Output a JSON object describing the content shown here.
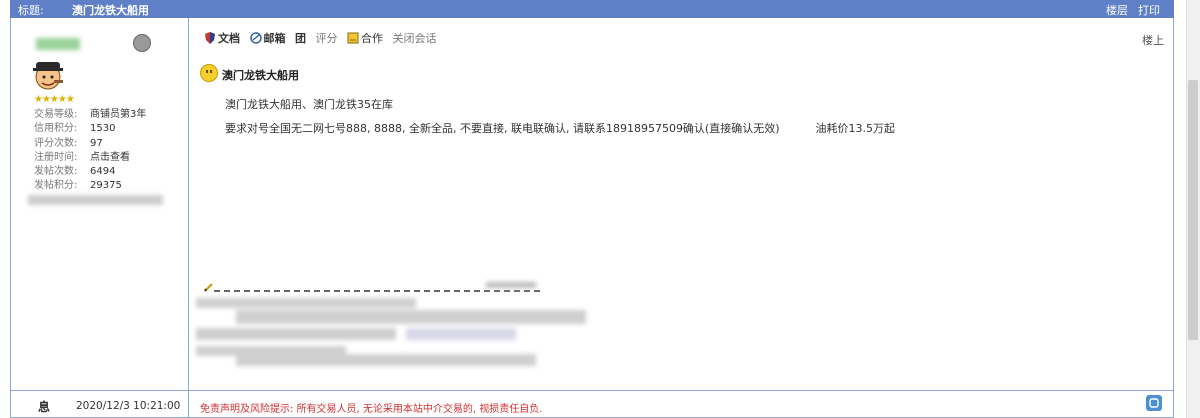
{
  "header": {
    "breadcrumb": "标题:",
    "title": "澳门龙铁大船用",
    "links": [
      "楼层",
      "打印"
    ]
  },
  "profile": {
    "stars": "★★★★★",
    "stats": [
      {
        "label": "交易等级:",
        "value": "商铺员第3年"
      },
      {
        "label": "信用积分:",
        "value": "1530"
      },
      {
        "label": "评分次数:",
        "value": "97"
      },
      {
        "label": "注册时间:",
        "value": "点击查看"
      },
      {
        "label": "发帖次数:",
        "value": "6494"
      },
      {
        "label": "发帖积分:",
        "value": "29375"
      }
    ]
  },
  "toolbar": {
    "items": [
      "文档",
      "邮箱",
      "团",
      "评分",
      "合作",
      "关闭会话"
    ],
    "top_link": "楼上"
  },
  "post": {
    "title": "澳门龙铁大船用",
    "line1": "澳门龙铁大船用、澳门龙铁35在库",
    "line2": "要求对号全国无二网七号888, 8888, 全新全品, 不要直接, 联电联确认, 请联系18918957509确认(直接确认无效)",
    "line2_price": "油耗价13.5万起"
  },
  "footer": {
    "icon_label": "息",
    "date": "2020/12/3 10:21:00",
    "disclaimer": "免责声明及风险提示: 所有交易人员, 无论采用本站中介交易的, 视损责任自负."
  },
  "colors": {
    "header_bg": "#5f80c6",
    "border": "#8fa8d8",
    "disclaimer": "#d23030"
  }
}
